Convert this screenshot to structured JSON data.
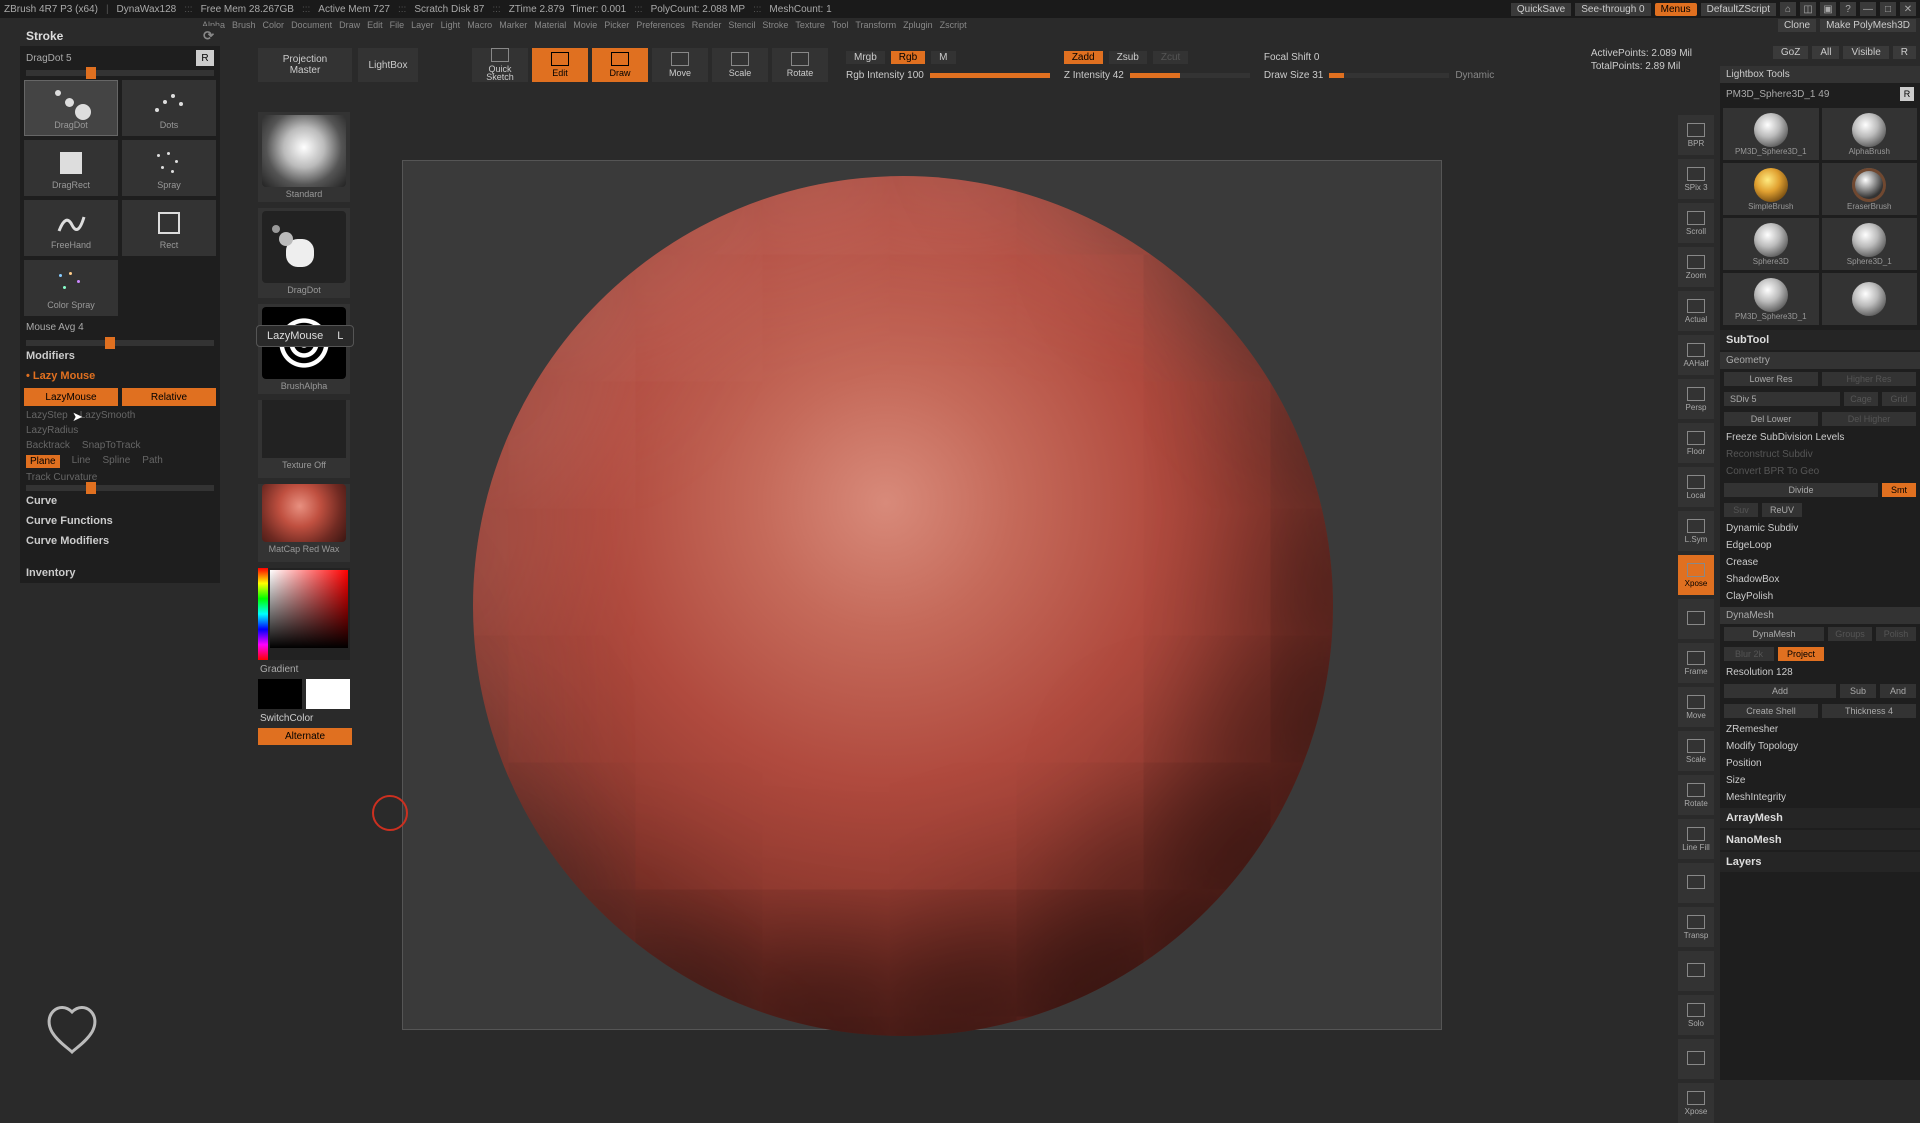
{
  "infobar": {
    "app": "ZBrush 4R7 P3 (x64)",
    "dynawax": "DynaWax128",
    "freemem": "Free Mem 28.267GB",
    "activemem": "Active Mem 727",
    "scratch": "Scratch Disk 87",
    "ztime": "ZTime 2.879",
    "timer": "Timer: 0.001",
    "polycount": "PolyCount: 2.088 MP",
    "meshcount": "MeshCount: 1",
    "quicksave": "QuickSave",
    "seethrough": "See-through  0",
    "menus": "Menus",
    "default": "DefaultZScript"
  },
  "tinymenu": [
    "Alpha",
    "Brush",
    "Color",
    "Document",
    "Draw",
    "Edit",
    "File",
    "Layer",
    "Light",
    "Macro",
    "Marker",
    "Material",
    "Movie",
    "Picker",
    "Preferences",
    "Render",
    "Stencil",
    "Stroke",
    "Texture",
    "Tool",
    "Transform",
    "Zplugin",
    "Zscript"
  ],
  "toolhdr": {
    "clone": "Clone",
    "poly": "Make PolyMesh3D"
  },
  "gozrow": {
    "goz": "GoZ",
    "all": "All",
    "visible": "Visible",
    "r": "R"
  },
  "hint": {
    "main": "LazyMouse",
    "key": "L"
  },
  "stroke": {
    "title": "Stroke",
    "dragdot": "DragDot  5",
    "r": "R",
    "cells": [
      "DragDot",
      "Dots",
      "",
      "DragRect",
      "",
      "Spray",
      "FreeHand",
      "Rect",
      "Color Spray",
      ""
    ],
    "mouseavg": "Mouse Avg 4",
    "modifiers": "Modifiers",
    "lazymouse": "Lazy Mouse",
    "lm_btn": "LazyMouse",
    "relative": "Relative",
    "lazystep": "LazyStep",
    "lazysmooth": "LazySmooth",
    "lazyradius": "LazyRadius",
    "backtrack": "Backtrack",
    "snaptrack": "SnapToTrack",
    "plane": "Plane",
    "line": "Line",
    "spline": "Spline",
    "path": "Path",
    "trackcurv": "Track Curvature",
    "curve": "Curve",
    "curvefn": "Curve Functions",
    "curvemod": "Curve Modifiers",
    "inventory": "Inventory"
  },
  "brushcol": {
    "proj1": "Projection",
    "proj2": "Master",
    "standard": "Standard",
    "dragdot": "DragDot",
    "brushalpha": "BrushAlpha",
    "texoff": "Texture Off",
    "matcap": "MatCap Red Wax",
    "gradient": "Gradient",
    "switch": "SwitchColor",
    "alternate": "Alternate"
  },
  "topbar": {
    "lightbox": "LightBox",
    "quick": "Quick",
    "sketch": "Sketch",
    "edit": "Edit",
    "draw": "Draw",
    "move": "Move",
    "scale": "Scale",
    "rotate": "Rotate",
    "mrgb": "Mrgb",
    "rgb": "Rgb",
    "m": "M",
    "rgbint": "Rgb Intensity 100",
    "zadd": "Zadd",
    "zsub": "Zsub",
    "zcut": "Zcut",
    "zint": "Z Intensity 42",
    "focal": "Focal Shift 0",
    "drawsize": "Draw Size 31",
    "dynamic": "Dynamic",
    "active": "ActivePoints: 2.089 Mil",
    "total": "TotalPoints: 2.89 Mil"
  },
  "rail": [
    "BPR",
    "SPix 3",
    "Scroll",
    "Zoom",
    "Actual",
    "AAHalf",
    "Persp",
    "Floor",
    "Local",
    "L.Sym",
    "Xpose",
    "",
    "Frame",
    "Move",
    "Scale",
    "Rotate",
    "Line Fill",
    "",
    "Transp",
    "",
    "Solo",
    "",
    "Xpose"
  ],
  "rail_on": [
    10
  ],
  "toolpanel": {
    "lightbox": "Lightbox  Tools",
    "current": "PM3D_Sphere3D_1  49",
    "tools": [
      "PM3D_Sphere3D_1",
      "AlphaBrush",
      "SimpleBrush",
      "EraserBrush",
      "Sphere3D",
      "Sphere3D_1",
      "PM3D_Sphere3D_1",
      ""
    ],
    "subtool": "SubTool",
    "geometry": "Geometry",
    "lowres": "Lower Res",
    "highres": "Higher Res",
    "sdiv": "SDiv 5",
    "cage": "Cage",
    "grid": "Grid",
    "dellower": "Del Lower",
    "delhigher": "Del Higher",
    "freeze": "Freeze SubDivision Levels",
    "reconstruct": "Reconstruct Subdiv",
    "convert": "Convert BPR To Geo",
    "divide": "Divide",
    "smt": "Smt",
    "suv": "Suv",
    "reuv": "ReUV",
    "dynsub": "Dynamic Subdiv",
    "edgeloop": "EdgeLoop",
    "crease": "Crease",
    "shadowbox": "ShadowBox",
    "claypolish": "ClayPolish",
    "dynamesh": "DynaMesh",
    "dyna": "DynaMesh",
    "groups": "Groups",
    "polish": "Polish",
    "blur": "Blur 2k",
    "project": "Project",
    "res": "Resolution 128",
    "add": "Add",
    "sub": "Sub",
    "and": "And",
    "shell": "Create Shell",
    "thick": "Thickness 4",
    "zrem": "ZRemesher",
    "modtop": "Modify Topology",
    "position": "Position",
    "size": "Size",
    "meshint": "MeshIntegrity",
    "arraymesh": "ArrayMesh",
    "nanomesh": "NanoMesh",
    "layers": "Layers"
  }
}
